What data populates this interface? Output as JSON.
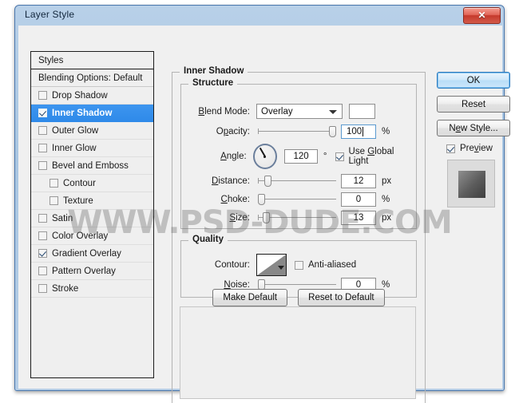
{
  "window": {
    "title": "Layer Style",
    "close_label": "✕"
  },
  "styles_panel": {
    "header": "Styles",
    "blending_options": "Blending Options: Default",
    "items": [
      {
        "label": "Drop Shadow",
        "checked": false,
        "indent": false,
        "selected": false
      },
      {
        "label": "Inner Shadow",
        "checked": true,
        "indent": false,
        "selected": true
      },
      {
        "label": "Outer Glow",
        "checked": false,
        "indent": false,
        "selected": false
      },
      {
        "label": "Inner Glow",
        "checked": false,
        "indent": false,
        "selected": false
      },
      {
        "label": "Bevel and Emboss",
        "checked": false,
        "indent": false,
        "selected": false
      },
      {
        "label": "Contour",
        "checked": false,
        "indent": true,
        "selected": false
      },
      {
        "label": "Texture",
        "checked": false,
        "indent": true,
        "selected": false
      },
      {
        "label": "Satin",
        "checked": false,
        "indent": false,
        "selected": false
      },
      {
        "label": "Color Overlay",
        "checked": false,
        "indent": false,
        "selected": false
      },
      {
        "label": "Gradient Overlay",
        "checked": true,
        "indent": false,
        "selected": false
      },
      {
        "label": "Pattern Overlay",
        "checked": false,
        "indent": false,
        "selected": false
      },
      {
        "label": "Stroke",
        "checked": false,
        "indent": false,
        "selected": false
      }
    ]
  },
  "panel": {
    "title": "Inner Shadow",
    "structure": {
      "legend": "Structure",
      "blend_mode_label": "Blend Mode:",
      "blend_mode_value": "Overlay",
      "color_swatch": "#ffffff",
      "opacity_label": "Opacity:",
      "opacity_value": "100",
      "opacity_unit": "%",
      "angle_label": "Angle:",
      "angle_value": "120",
      "angle_unit": "°",
      "use_global_light_label": "Use Global Light",
      "use_global_light_checked": true,
      "distance_label": "Distance:",
      "distance_value": "12",
      "distance_unit": "px",
      "choke_label": "Choke:",
      "choke_value": "0",
      "choke_unit": "%",
      "size_label": "Size:",
      "size_value": "13",
      "size_unit": "px"
    },
    "quality": {
      "legend": "Quality",
      "contour_label": "Contour:",
      "anti_aliased_label": "Anti-aliased",
      "anti_aliased_checked": false,
      "noise_label": "Noise:",
      "noise_value": "0",
      "noise_unit": "%"
    },
    "footer": {
      "make_default": "Make Default",
      "reset_to_default": "Reset to Default"
    }
  },
  "actions": {
    "ok": "OK",
    "reset": "Reset",
    "new_style": "New Style...",
    "preview_label": "Preview",
    "preview_checked": true
  },
  "watermark": {
    "text": "WWW.PSD-DUDE.COM"
  }
}
